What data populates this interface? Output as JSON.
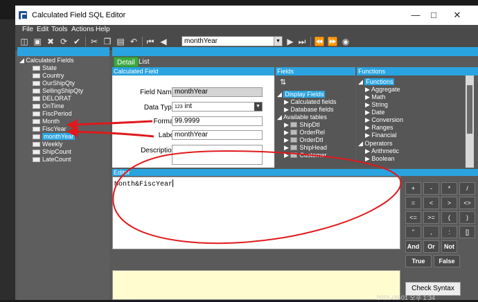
{
  "window": {
    "title": "Calculated Field SQL Editor"
  },
  "menu": [
    "File",
    "Edit",
    "Tools",
    "Actions",
    "Help"
  ],
  "toolbar": {
    "record": "monthYear"
  },
  "tree": {
    "root": "Calculated Fields",
    "items": [
      "State",
      "Country",
      "OurShipQty",
      "SellingShipQty",
      "DELORAT",
      "OnTime",
      "FiscPeriod",
      "Month",
      "FiscYear",
      "monthYear",
      "Weekly",
      "ShipCount",
      "LateCount"
    ]
  },
  "tabs": {
    "detail": "Detail",
    "list": "List"
  },
  "panels": {
    "calc": "Calculated Field",
    "fields": "Fields",
    "functions": "Functions"
  },
  "form": {
    "name_label": "Field Name:",
    "name_value": "monthYear",
    "type_label": "Data Type:",
    "type_prefix": "123",
    "type_value": "int",
    "format_label": "Format:",
    "format_value": "99.9999",
    "label_label": "Label:",
    "label_value": "monthYear",
    "desc_label": "Description:"
  },
  "fields_tree": {
    "display": "Display Fields",
    "calc": "Calculated fields",
    "db": "Database fields",
    "avail": "Available tables",
    "tables": [
      "ShipDtl",
      "OrderRel",
      "OrderDtl",
      "ShipHead",
      "Customer"
    ]
  },
  "functions_tree": {
    "root": "Functions",
    "items": [
      "Aggregate",
      "Math",
      "String",
      "Date",
      "Conversion",
      "Ranges",
      "Financial"
    ],
    "operators": "Operators",
    "op_items": [
      "Arithmetic",
      "Boolean"
    ]
  },
  "editor": {
    "label": "Editor",
    "text": "Month&FiscYear"
  },
  "keypad": {
    "rows": [
      [
        "+",
        "-",
        "*",
        "/"
      ],
      [
        "=",
        "<",
        ">",
        "<>"
      ],
      [
        "<=",
        ">=",
        "(",
        ")"
      ],
      [
        "\"",
        ",",
        ":",
        "[]"
      ]
    ],
    "and": "And",
    "or": "Or",
    "not": "Not",
    "true": "True",
    "false": "False",
    "check": "Check Syntax"
  },
  "status": {
    "text": "2021-09-01 오후 1:34"
  },
  "colors": {
    "accent": "#2aa4e0",
    "annotation": "#e0191c",
    "tab_active": "#3ea842"
  }
}
